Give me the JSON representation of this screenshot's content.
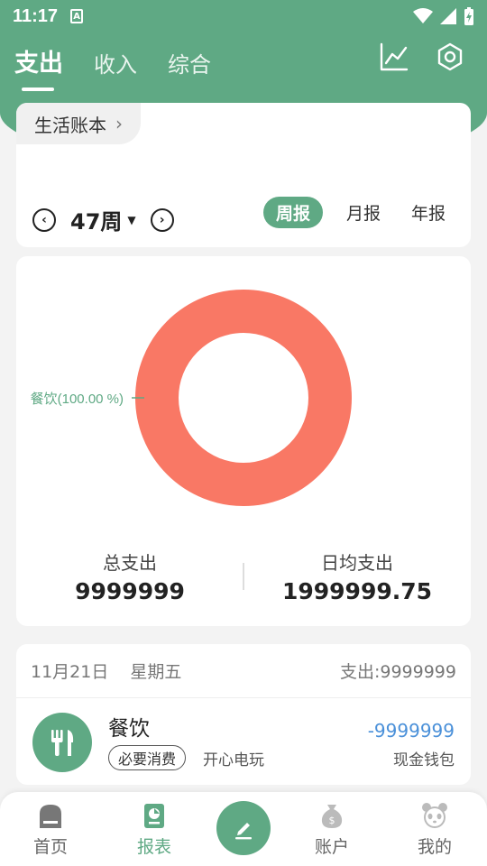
{
  "status_bar": {
    "time": "11:17",
    "notif_glyph": "A"
  },
  "top_tabs": [
    {
      "label": "支出",
      "active": true
    },
    {
      "label": "收入",
      "active": false
    },
    {
      "label": "综合",
      "active": false
    }
  ],
  "top_icons": [
    "trend-chart-icon",
    "settings-hexagon-icon"
  ],
  "book": {
    "name": "生活账本",
    "chevron": "›"
  },
  "week": {
    "label": "47周",
    "caret": "▼",
    "prev": "‹",
    "next": "›"
  },
  "period_tabs": [
    {
      "label": "周报",
      "active": true
    },
    {
      "label": "月报",
      "active": false
    },
    {
      "label": "年报",
      "active": false
    }
  ],
  "chart_data": {
    "type": "pie",
    "categories": [
      "餐饮"
    ],
    "values": [
      100.0
    ],
    "labels": [
      "餐饮(100.00 %)"
    ],
    "colors": [
      "#f97865"
    ],
    "donut": true
  },
  "totals": {
    "total_label": "总支出",
    "total_value": "9999999",
    "daily_label": "日均支出",
    "daily_value": "1999999.75"
  },
  "day": {
    "date": "11月21日",
    "weekday": "星期五",
    "total": "支出:9999999"
  },
  "entry": {
    "category": "餐饮",
    "tag": "必要消费",
    "note": "开心电玩",
    "amount": "-9999999",
    "account": "现金钱包",
    "icon": "fork-knife-icon"
  },
  "bottom_nav": [
    {
      "label": "首页",
      "icon": "home-icon",
      "active": false
    },
    {
      "label": "报表",
      "icon": "report-icon",
      "active": true
    },
    {
      "label": "账户",
      "icon": "money-bag-icon",
      "active": false
    },
    {
      "label": "我的",
      "icon": "panda-icon",
      "active": false
    }
  ],
  "colors": {
    "primary": "#5fa984",
    "slice": "#f97865",
    "amount": "#4a90d9"
  }
}
